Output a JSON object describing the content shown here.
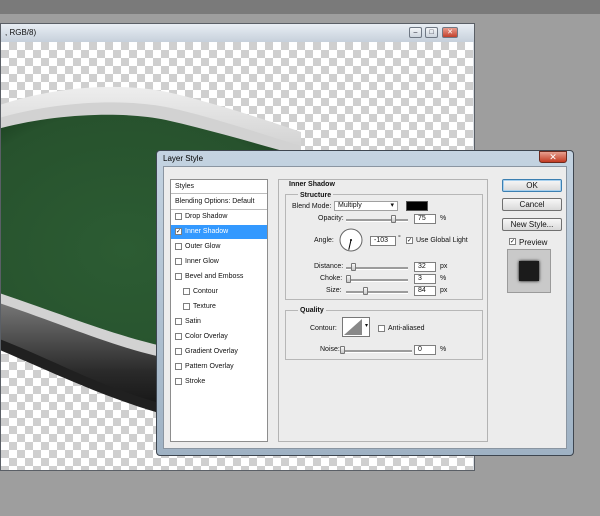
{
  "document": {
    "title_fragment": ", RGB/8)",
    "window_buttons": {
      "minimize": "–",
      "maximize": "□",
      "close": "✕"
    }
  },
  "dialog": {
    "title": "Layer Style",
    "close_glyph": "✕",
    "styles_list": {
      "header": "Styles",
      "blending": "Blending Options: Default",
      "items": [
        {
          "label": "Drop Shadow",
          "checked": false,
          "indent": false,
          "selected": false
        },
        {
          "label": "Inner Shadow",
          "checked": true,
          "indent": false,
          "selected": true
        },
        {
          "label": "Outer Glow",
          "checked": false,
          "indent": false,
          "selected": false
        },
        {
          "label": "Inner Glow",
          "checked": false,
          "indent": false,
          "selected": false
        },
        {
          "label": "Bevel and Emboss",
          "checked": false,
          "indent": false,
          "selected": false
        },
        {
          "label": "Contour",
          "checked": false,
          "indent": true,
          "selected": false
        },
        {
          "label": "Texture",
          "checked": false,
          "indent": true,
          "selected": false
        },
        {
          "label": "Satin",
          "checked": false,
          "indent": false,
          "selected": false
        },
        {
          "label": "Color Overlay",
          "checked": false,
          "indent": false,
          "selected": false
        },
        {
          "label": "Gradient Overlay",
          "checked": false,
          "indent": false,
          "selected": false
        },
        {
          "label": "Pattern Overlay",
          "checked": false,
          "indent": false,
          "selected": false
        },
        {
          "label": "Stroke",
          "checked": false,
          "indent": false,
          "selected": false
        }
      ]
    },
    "inner_shadow": {
      "section_title": "Inner Shadow",
      "structure_title": "Structure",
      "blend_mode_label": "Blend Mode:",
      "blend_mode_value": "Multiply",
      "shadow_color": "#000000",
      "opacity_label": "Opacity:",
      "opacity_value": "75",
      "opacity_unit": "%",
      "opacity_fraction": 0.75,
      "angle_label": "Angle:",
      "angle_value": "-103",
      "angle_unit": "°",
      "angle_degrees": -103,
      "use_global_light_label": "Use Global Light",
      "use_global_light": true,
      "distance_label": "Distance:",
      "distance_value": "32",
      "distance_unit": "px",
      "distance_fraction": 0.11,
      "choke_label": "Choke:",
      "choke_value": "3",
      "choke_unit": "%",
      "choke_fraction": 0.03,
      "size_label": "Size:",
      "size_value": "84",
      "size_unit": "px",
      "size_fraction": 0.3
    },
    "quality": {
      "title": "Quality",
      "contour_label": "Contour:",
      "anti_aliased_label": "Anti-aliased",
      "anti_aliased": false,
      "noise_label": "Noise:",
      "noise_value": "0",
      "noise_unit": "%",
      "noise_fraction": 0
    },
    "buttons": {
      "ok": "OK",
      "cancel": "Cancel",
      "new_style": "New Style...",
      "preview_label": "Preview",
      "preview_checked": true
    },
    "colors": {
      "selection": "#3399ff",
      "canvas_shape": "#2a5a32"
    }
  }
}
